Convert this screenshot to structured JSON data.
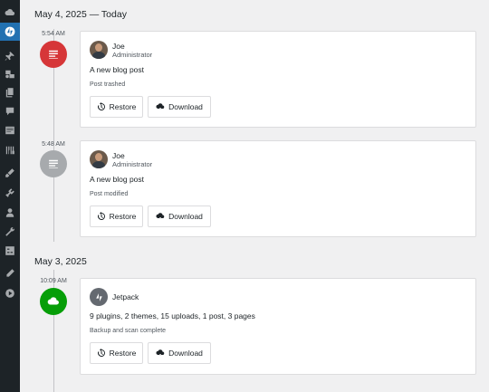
{
  "sidebar": {
    "icons": [
      "cloud-icon",
      "jetpack-icon",
      "pin-icon",
      "media-icon",
      "pages-icon",
      "comments-icon",
      "feedback-icon",
      "woocommerce-icon",
      "appearance-icon",
      "plugins-icon",
      "users-icon",
      "tools-icon",
      "settings-icon",
      "edit-icon",
      "play-icon"
    ]
  },
  "groups": [
    {
      "date": "May 4, 2025 — Today",
      "events": [
        {
          "time": "5:54 AM",
          "actor_name": "Joe",
          "actor_role": "Administrator",
          "summary": "A new blog post",
          "status": "Post trashed",
          "node_color": "#d63638"
        },
        {
          "time": "5:48 AM",
          "actor_name": "Joe",
          "actor_role": "Administrator",
          "summary": "A new blog post",
          "status": "Post modified",
          "node_color": "#a7aaad"
        }
      ]
    },
    {
      "date": "May 3, 2025",
      "events": [
        {
          "time": "10:09 AM",
          "actor_name": "Jetpack",
          "summary": "9 plugins, 2 themes, 15 uploads, 1 post, 3 pages",
          "status": "Backup and scan complete",
          "node_color": "#069e08"
        }
      ]
    }
  ],
  "actions": {
    "restore_label": "Restore",
    "download_label": "Download"
  },
  "colors": {
    "sidebar_bg": "#1d2327",
    "sidebar_active": "#2271b1",
    "trash_red": "#d63638",
    "modified_gray": "#a7aaad",
    "backup_green": "#069e08"
  }
}
